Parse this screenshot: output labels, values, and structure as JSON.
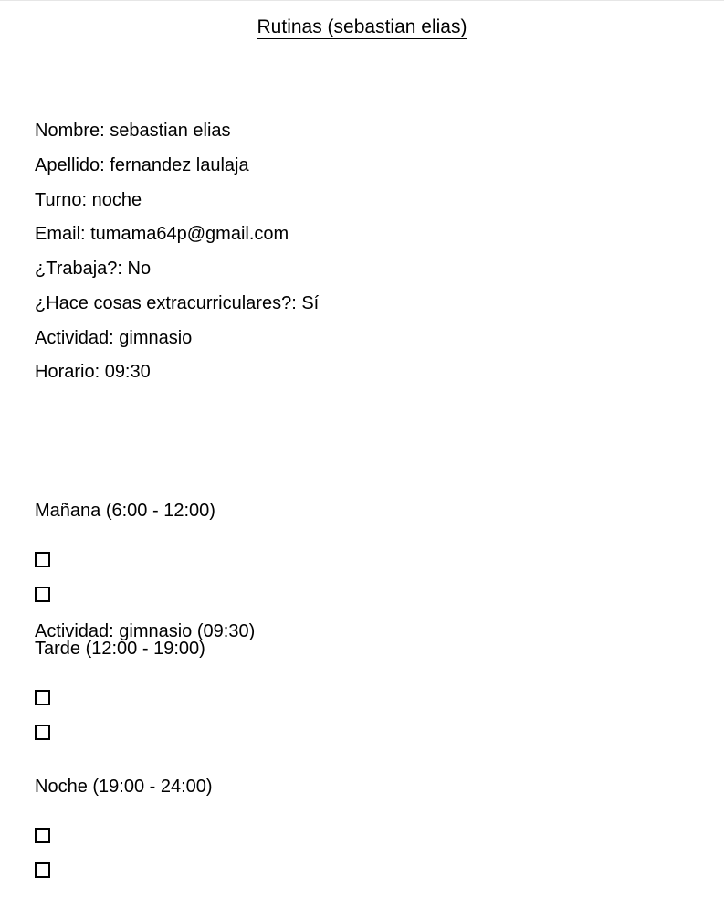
{
  "title": "Rutinas (sebastian elias)",
  "fields": [
    "Nombre: sebastian elias",
    "Apellido: fernandez laulaja",
    "Turno: noche",
    "Email: tumama64p@gmail.com",
    "¿Trabaja?: No",
    "¿Hace cosas extracurriculares?: Sí",
    "Actividad: gimnasio",
    "Horario: 09:30"
  ],
  "sections": {
    "morning": {
      "heading": "Mañana (6:00 - 12:00)",
      "activity": "Actividad: gimnasio (09:30)"
    },
    "afternoon": {
      "heading": "Tarde (12:00 - 19:00)"
    },
    "night": {
      "heading": "Noche (19:00 - 24:00)"
    }
  }
}
